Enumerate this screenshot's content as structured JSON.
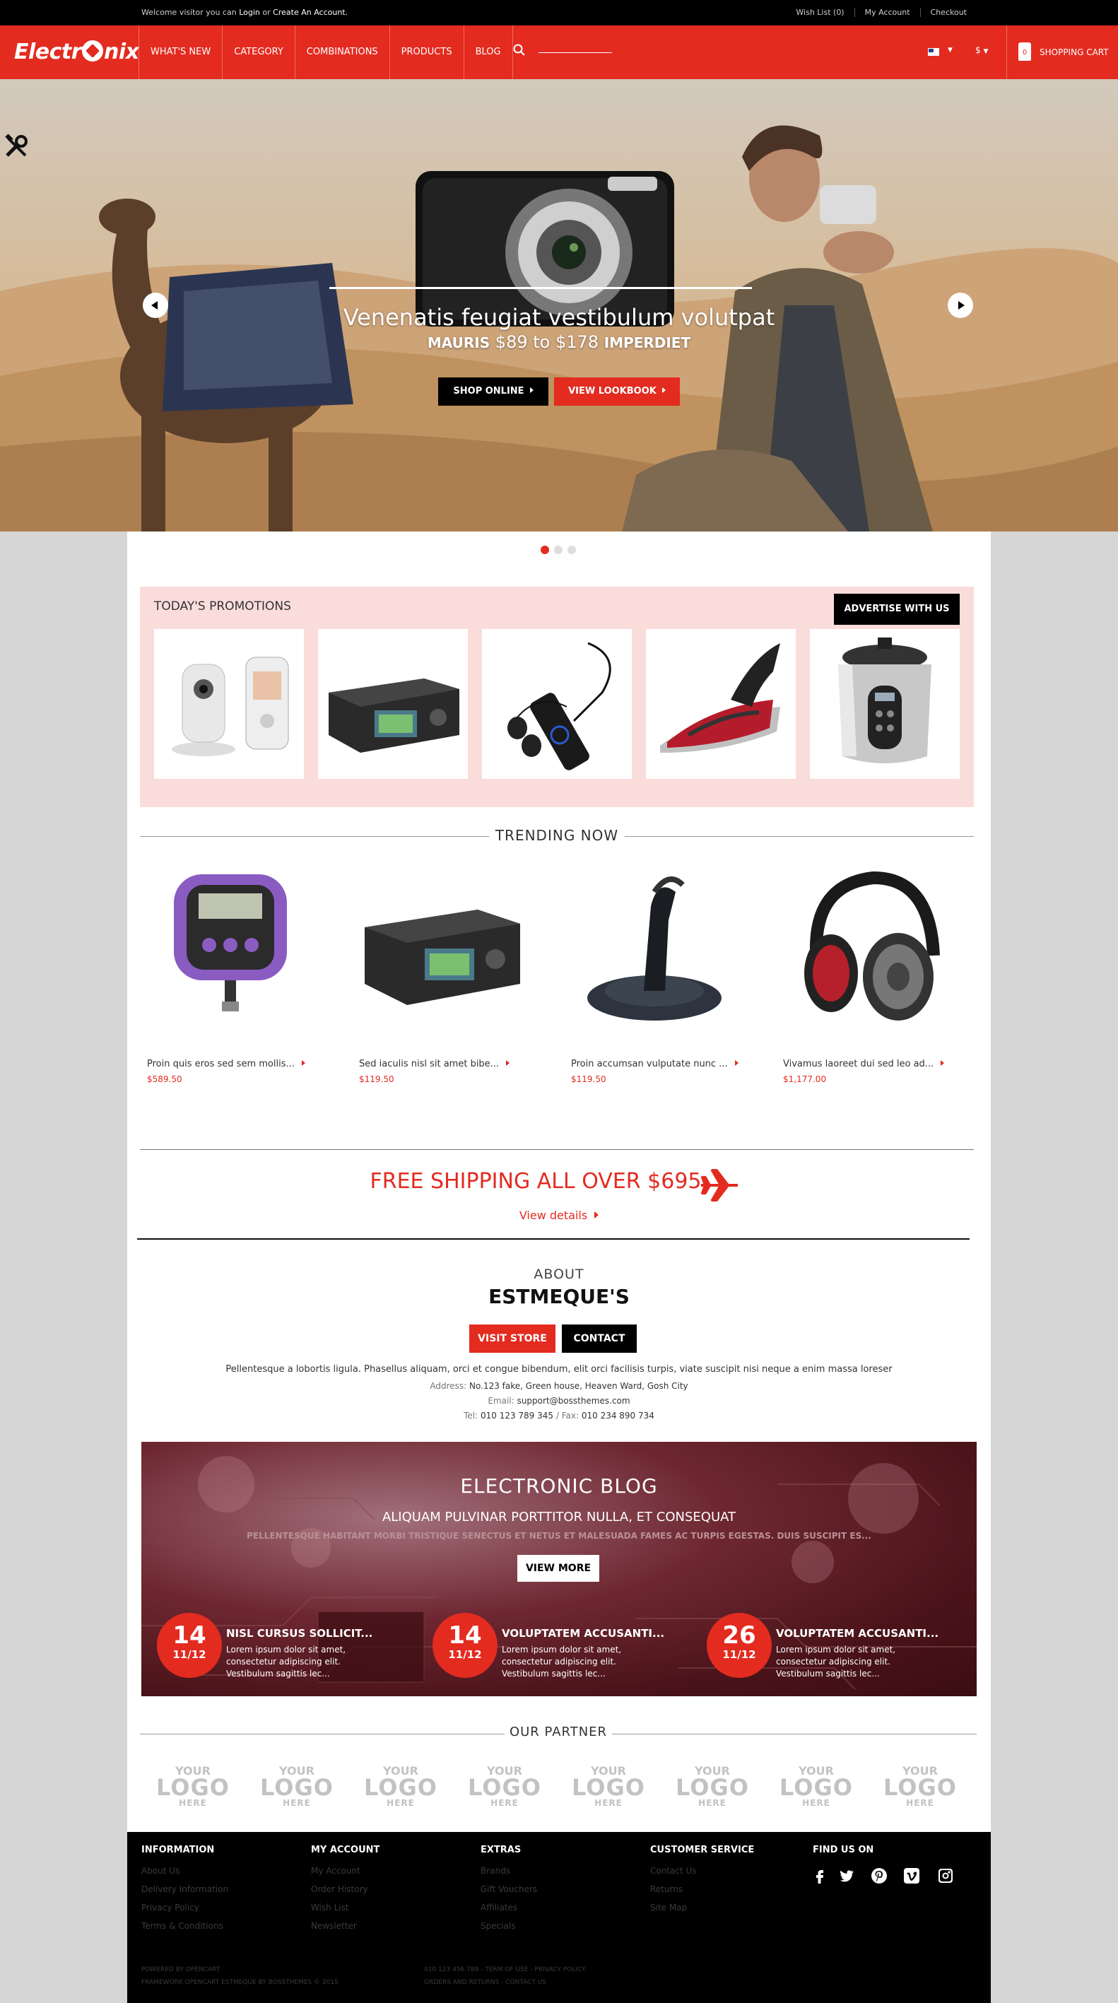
{
  "topbar": {
    "welcome_prefix": "Welcome visitor you can",
    "login": "Login",
    "or": "or",
    "create_account": "Create An Account.",
    "wishlist": "Wish List (0)",
    "my_account": "My Account",
    "checkout": "Checkout"
  },
  "header": {
    "logo_left": "Electr",
    "logo_right": "nix",
    "nav": [
      "WHAT'S NEW",
      "CATEGORY",
      "COMBINATIONS",
      "PRODUCTS",
      "BLOG"
    ],
    "currency": "$",
    "cart_count": "0",
    "cart_label": "SHOPPING CART"
  },
  "hero": {
    "title": "Venenatis feugiat vestibulum volutpat",
    "sub_left": "MAURIS",
    "sub_price": "$89 to $178",
    "sub_right": "IMPERDIET",
    "shop_btn": "SHOP ONLINE",
    "lookbook_btn": "VIEW LOOKBOOK"
  },
  "promotions": {
    "title": "TODAY'S PROMOTIONS",
    "advertise": "ADVERTISE WITH US"
  },
  "trending": {
    "title": "TRENDING NOW",
    "products": [
      {
        "name": "Proin quis eros sed sem mollis...",
        "price": "$589.50"
      },
      {
        "name": "Sed iaculis nisl sit amet bibe...",
        "price": "$119.50"
      },
      {
        "name": "Proin accumsan vulputate nunc ...",
        "price": "$119.50"
      },
      {
        "name": "Vivamus laoreet dui sed leo ad...",
        "price": "$1,177.00"
      }
    ]
  },
  "shipping": {
    "text": "FREE SHIPPING ALL OVER $695",
    "link": "View details"
  },
  "about": {
    "heading": "ABOUT",
    "name": "ESTMEQUE'S",
    "visit": "VISIT STORE",
    "contact": "CONTACT",
    "desc": "Pellentesque a lobortis ligula. Phasellus aliquam, orci et congue bibendum, elit orci facilisis turpis, viate suscipit nisi neque a enim massa loreser",
    "address_label": "Address:",
    "address": "No.123 fake, Green house, Heaven Ward, Gosh City",
    "email_label": "Email:",
    "email": "support@bossthemes.com",
    "tel_label": "Tel:",
    "tel": "010 123 789 345",
    "fax_label": "/ Fax:",
    "fax": "010 234 890 734"
  },
  "blog": {
    "title": "ELECTRONIC BLOG",
    "subtitle": "ALIQUAM PULVINAR PORTTITOR NULLA, ET CONSEQUAT",
    "subtitle2": "PELLENTESQUE HABITANT MORBI TRISTIQUE SENECTUS ET NETUS ET MALESUADA FAMES AC TURPIS EGESTAS. DUIS SUSCIPIT ES...",
    "view_more": "VIEW MORE",
    "posts": [
      {
        "day": "14",
        "month": "11/12",
        "title": "NISL CURSUS SOLLICIT...",
        "desc": "Lorem ipsum dolor sit amet, consectetur adipiscing elit. Vestibulum sagittis lec..."
      },
      {
        "day": "14",
        "month": "11/12",
        "title": "VOLUPTATEM ACCUSANTI...",
        "desc": "Lorem ipsum dolor sit amet, consectetur adipiscing elit. Vestibulum sagittis lec..."
      },
      {
        "day": "26",
        "month": "11/12",
        "title": "VOLUPTATEM ACCUSANTI...",
        "desc": "Lorem ipsum dolor sit amet, consectetur adipiscing elit. Vestibulum sagittis lec..."
      }
    ]
  },
  "partner": {
    "title": "OUR PARTNER",
    "logo_top": "YOUR",
    "logo_mid": "LOGO",
    "logo_bottom": "HERE"
  },
  "footer": {
    "columns": [
      {
        "title": "INFORMATION",
        "items": [
          "About Us",
          "Delivery Information",
          "Privacy Policy",
          "Terms & Conditions"
        ]
      },
      {
        "title": "MY ACCOUNT",
        "items": [
          "My Account",
          "Order History",
          "Wish List",
          "Newsletter"
        ]
      },
      {
        "title": "EXTRAS",
        "items": [
          "Brands",
          "Gift Vouchers",
          "Affiliates",
          "Specials"
        ]
      },
      {
        "title": "CUSTOMER SERVICE",
        "items": [
          "Contact Us",
          "Returns",
          "Site Map"
        ]
      }
    ],
    "find_us": "FIND US ON",
    "copy1": "POWERED BY OPENCART",
    "copy2": "FRAMEWORK OPENCART ESTMEQUE BY BOSSTHEMES © 2015",
    "copy3": "010 123 456 789 - TERM OF USE - PRIVACY POLICY",
    "copy4": "ORDERS AND RETURNS - CONTACT US"
  },
  "colors": {
    "accent": "#e32b20",
    "promo_bg": "#fadcdb",
    "dark": "#000000"
  }
}
